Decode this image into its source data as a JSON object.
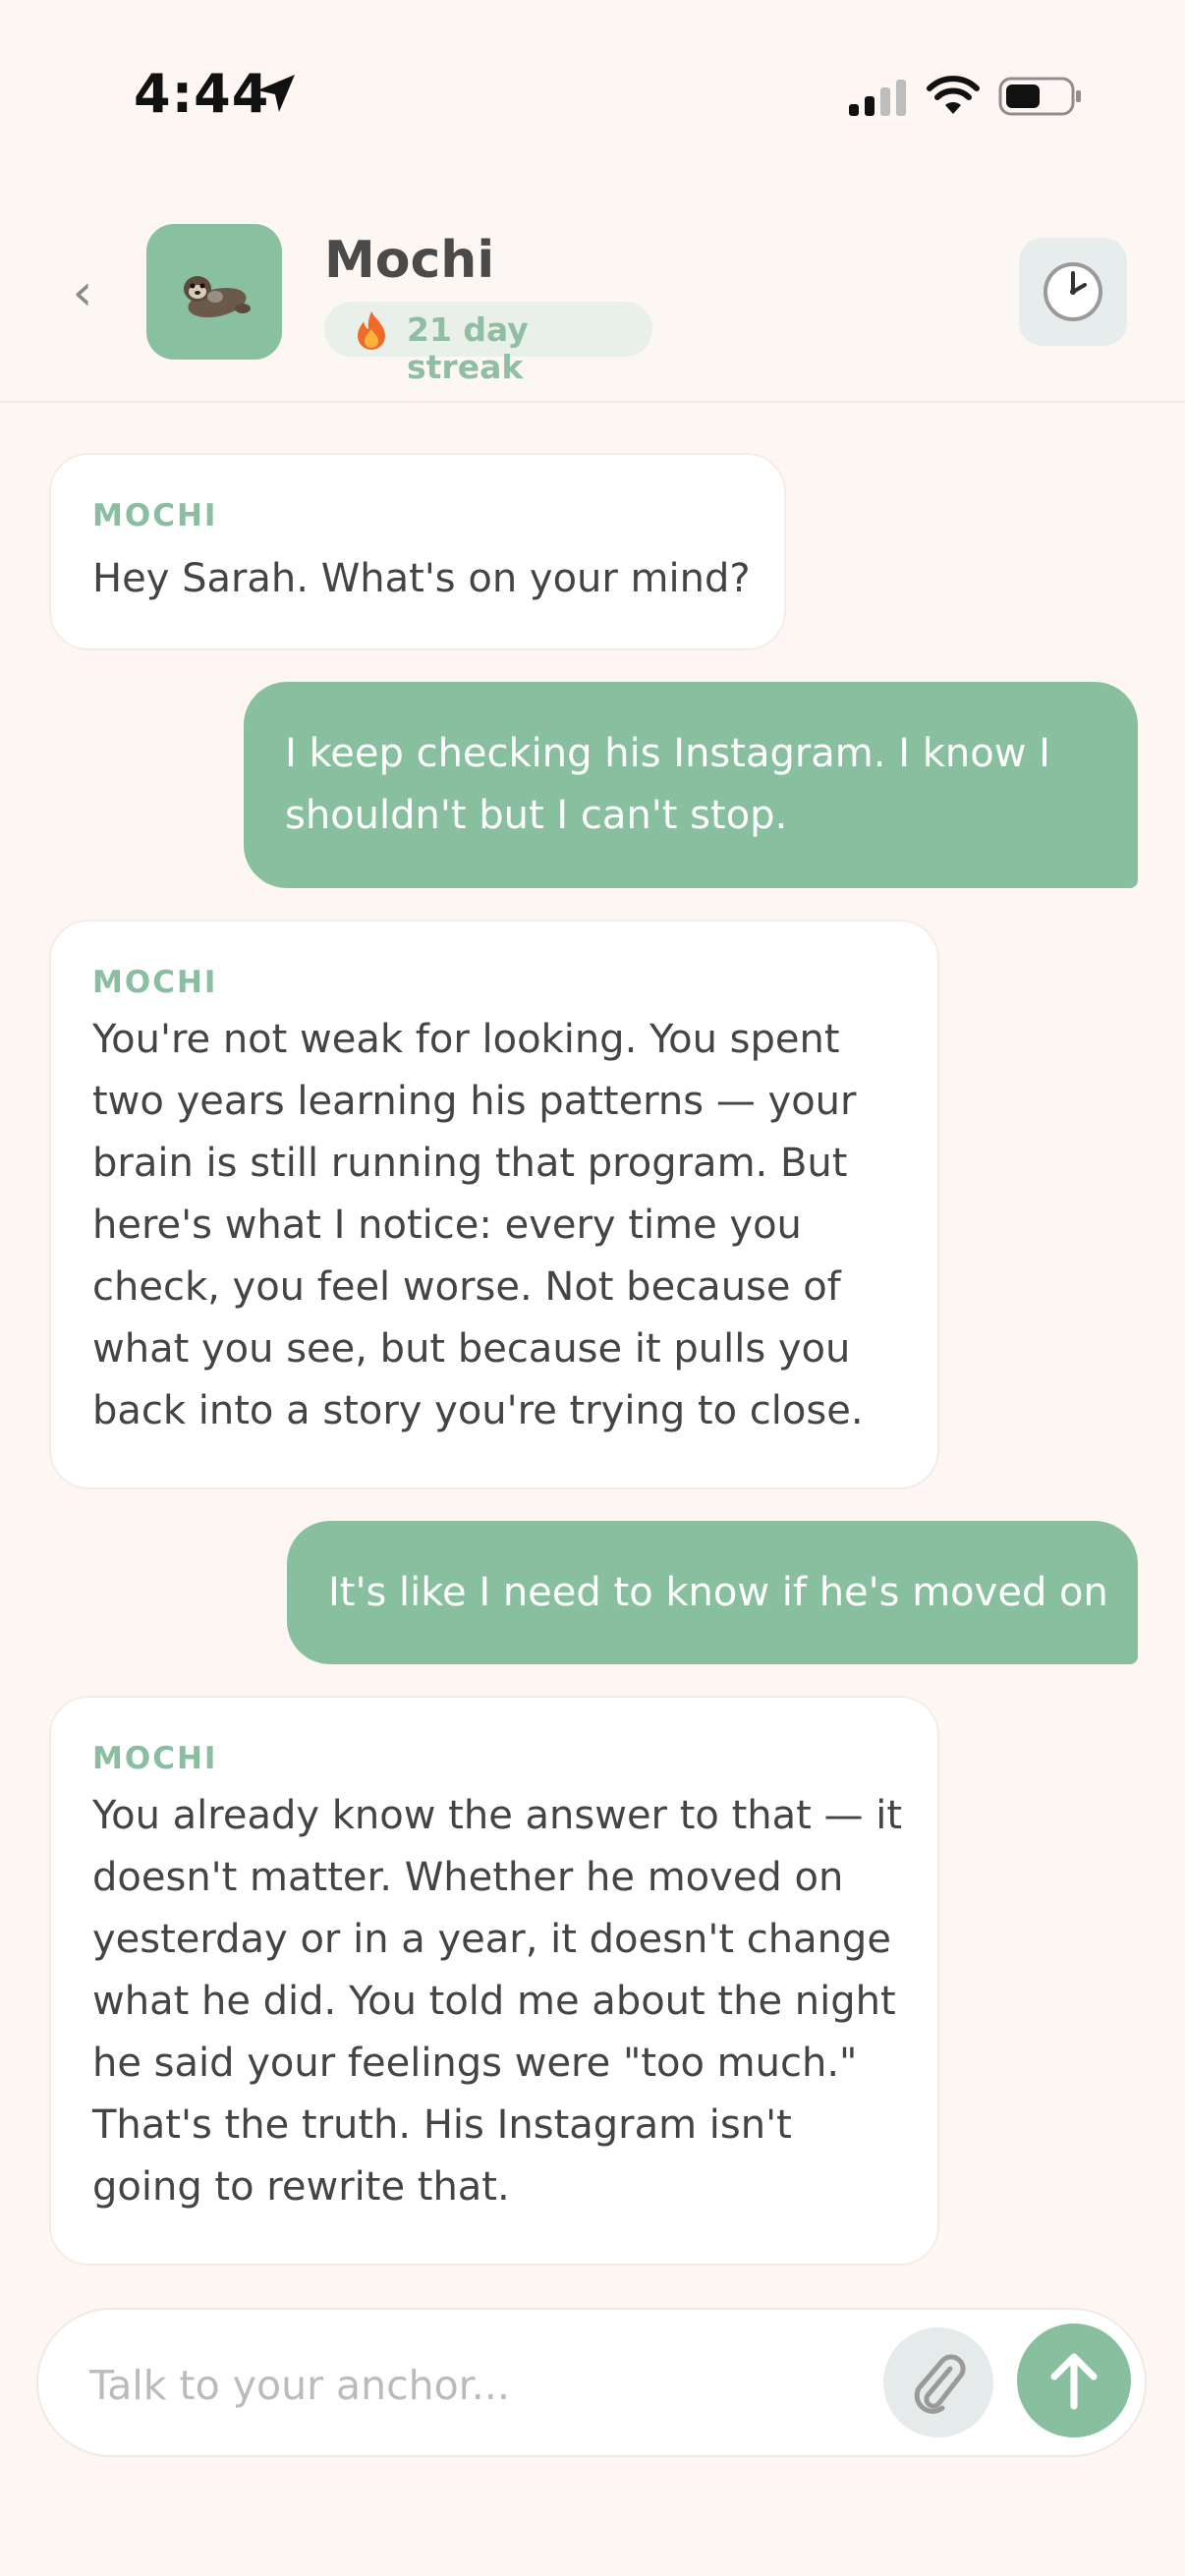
{
  "status_bar": {
    "time": "4:44",
    "icons": [
      "location-arrow-icon",
      "signal-icon",
      "wifi-icon",
      "battery-icon"
    ]
  },
  "header": {
    "back_icon": "chevron-left-icon",
    "back_glyph": "‹",
    "avatar_icon": "otter-avatar",
    "name": "Mochi",
    "streak_icon": "fire-icon",
    "streak": "21 day streak",
    "history_icon": "clock-icon"
  },
  "messages": [
    {
      "from": "bot",
      "sender": "MOCHI",
      "text": "Hey Sarah. What's on your mind?"
    },
    {
      "from": "user",
      "text": "I keep checking his Instagram. I know I\nshouldn't but I can't stop."
    },
    {
      "from": "bot",
      "sender": "MOCHI",
      "text": "You're not weak for looking. You spent\ntwo years learning his patterns — your\nbrain is still running that program. But\nhere's what I notice: every time you\ncheck, you feel worse. Not because of\nwhat you see, but because it pulls you\nback into a story you're trying to close."
    },
    {
      "from": "user",
      "text": "It's like I need to know if he's moved on"
    },
    {
      "from": "bot",
      "sender": "MOCHI",
      "text": "You already know the answer to that — it\ndoesn't matter. Whether he moved on\nyesterday or in a year, it doesn't change\nwhat he did. You told me about the night\nhe said your feelings were \"too much.\"\nThat's the truth. His Instagram isn't\ngoing to rewrite that."
    }
  ],
  "composer": {
    "placeholder": "Talk to your anchor...",
    "attach_icon": "paperclip-icon",
    "send_icon": "arrow-up-icon"
  },
  "colors": {
    "background": "#fdf6f2",
    "accent": "#88c09f",
    "bot_bubble": "#ffffff",
    "sender_label": "#89bea0"
  }
}
